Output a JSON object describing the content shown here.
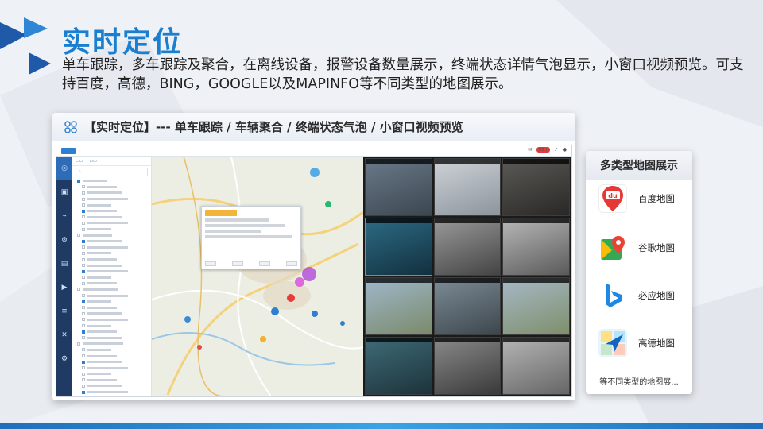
{
  "slide": {
    "title": "实时定位",
    "description": "单车跟踪，多车跟踪及聚合，在离线设备，报警设备数量展示，终端状态详情气泡显示，小窗口视频预览。可支持百度，高德，BING，GOOGLE以及MAPINFO等不同类型的地图展示。"
  },
  "panel": {
    "header": "【实时定位】--- 单车跟踪 / 车辆聚合 / 终端状态气泡 / 小窗口视频预览",
    "app": {
      "sidebar": [
        {
          "icon": "locate-icon",
          "glyph": "◎"
        },
        {
          "icon": "monitor-icon",
          "glyph": "▣"
        },
        {
          "icon": "track-icon",
          "glyph": "⌁"
        },
        {
          "icon": "alarm-icon",
          "glyph": "⊛"
        },
        {
          "icon": "report-icon",
          "glyph": "▤"
        },
        {
          "icon": "video-icon",
          "glyph": "▶"
        },
        {
          "icon": "list-icon",
          "glyph": "≡"
        },
        {
          "icon": "tools-icon",
          "glyph": "✕"
        },
        {
          "icon": "settings-icon",
          "glyph": "⚙"
        }
      ],
      "alert_count": "99+",
      "video_tiles": 12
    }
  },
  "map_types": {
    "title": "多类型地图展示",
    "items": [
      {
        "label": "百度地图",
        "icon": "baidu-map-icon",
        "color": "#e53935"
      },
      {
        "label": "谷歌地图",
        "icon": "google-map-icon",
        "color": "#34a853"
      },
      {
        "label": "必应地图",
        "icon": "bing-map-icon",
        "color": "#1e88e5"
      },
      {
        "label": "高德地图",
        "icon": "amap-icon",
        "color": "#1565c0"
      }
    ],
    "footer": "等不同类型的地图展..."
  },
  "colors": {
    "title": "#1a7fd0",
    "accent": "#2f7fd0",
    "sidebar": "#1f3a63"
  }
}
